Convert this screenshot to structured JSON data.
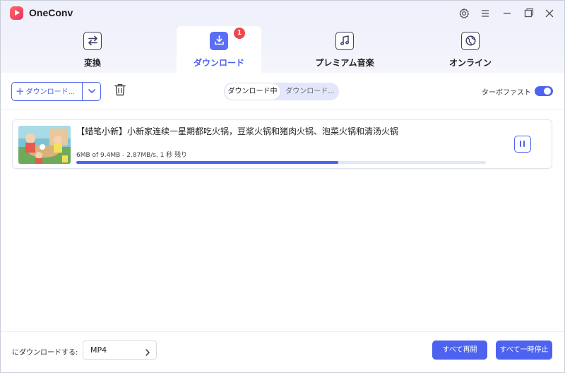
{
  "app": {
    "title": "OneConv"
  },
  "titlebar": {
    "icons": [
      "gear-icon",
      "menu-icon",
      "minimize-icon",
      "maximize-icon",
      "close-icon"
    ]
  },
  "tabs": [
    {
      "label": "変換",
      "icon": "convert-icon",
      "active": false
    },
    {
      "label": "ダウンロード",
      "icon": "download-icon",
      "active": true,
      "badge": "1"
    },
    {
      "label": "プレミアム音楽",
      "icon": "music-note-icon",
      "active": false
    },
    {
      "label": "オンライン",
      "icon": "globe-icon",
      "active": false
    }
  ],
  "toolbar": {
    "download_button_label": "ダウンロード...",
    "segment": {
      "active": "ダウンロード中",
      "inactive": "ダウンロード..."
    },
    "turbo_label": "ターボファスト",
    "turbo_on": true
  },
  "downloads": [
    {
      "title": "【蜡笔小新】小新家连续一星期都吃火锅，豆浆火锅和猪肉火锅、泡菜火锅和清汤火锅",
      "progress_text": "6MB of 9.4MB -    2.87MB/s, 1 秒 残り",
      "progress_fraction": 0.64
    }
  ],
  "footer": {
    "download_to_label": "にダウンロードする:",
    "format_value": "MP4",
    "resume_all_label": "すべて再開",
    "pause_all_label": "すべて一時停止"
  },
  "colors": {
    "accent": "#4d63f0",
    "badge": "#f2444a",
    "brand_start": "#ff6a5a",
    "brand_end": "#e8306c"
  }
}
